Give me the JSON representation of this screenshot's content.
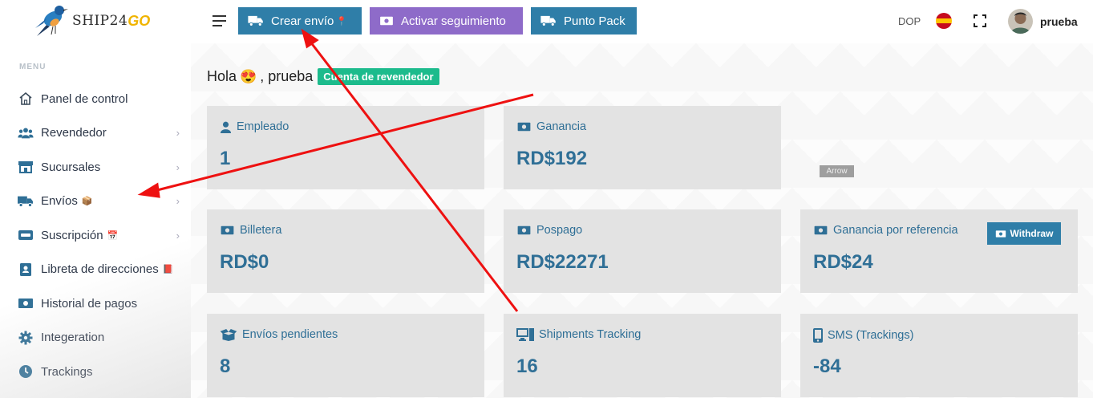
{
  "logo": {
    "text": "SHIP24",
    "go": "GO"
  },
  "sidebar": {
    "heading": "MENU",
    "items": [
      {
        "label": "Panel de control",
        "icon": "home-icon",
        "emoji": "",
        "chevron": false
      },
      {
        "label": "Revendedor",
        "icon": "users-icon",
        "emoji": "",
        "chevron": true
      },
      {
        "label": "Sucursales",
        "icon": "store-icon",
        "emoji": "",
        "chevron": true
      },
      {
        "label": "Envíos",
        "icon": "truck-icon",
        "emoji": "📦",
        "chevron": true
      },
      {
        "label": "Suscripción",
        "icon": "card-icon",
        "emoji": "📅",
        "chevron": true
      },
      {
        "label": "Libreta de direcciones",
        "icon": "contact-book-icon",
        "emoji": "📕",
        "chevron": false
      },
      {
        "label": "Historial de pagos",
        "icon": "money-icon",
        "emoji": "",
        "chevron": false
      },
      {
        "label": "Integeration",
        "icon": "gear-icon",
        "emoji": "",
        "chevron": false
      },
      {
        "label": "Trackings",
        "icon": "clock-icon",
        "emoji": "",
        "chevron": false
      }
    ]
  },
  "topbar": {
    "crear": "Crear envío",
    "crear_emoji": "📍",
    "activar": "Activar seguimiento",
    "punto": "Punto Pack",
    "currency": "DOP",
    "username": "prueba"
  },
  "greeting": {
    "hola": "Hola",
    "emoji": "😍",
    "name": ", prueba",
    "badge": "Cuenta de revendedor"
  },
  "cards": {
    "empleado": {
      "title": "Empleado",
      "value": "1"
    },
    "ganancia": {
      "title": "Ganancia",
      "value": "RD$192"
    },
    "billetera": {
      "title": "Billetera",
      "value": "RD$0"
    },
    "pospago": {
      "title": "Pospago",
      "value": "RD$22271"
    },
    "referencia": {
      "title": "Ganancia por referencia",
      "value": "RD$24",
      "button": "Withdraw",
      "tooltip": "Arrow"
    },
    "pendientes": {
      "title": "Envíos pendientes",
      "value": "8"
    },
    "tracking": {
      "title": "Shipments Tracking",
      "value": "16"
    },
    "sms": {
      "title": "SMS (Trackings)",
      "value": "-84"
    }
  },
  "colors": {
    "primary": "#2f7ea8",
    "purple": "#8e6bc9",
    "green": "#1cbb8c",
    "card": "#e3e3e3",
    "arrow": "#ee1111"
  }
}
